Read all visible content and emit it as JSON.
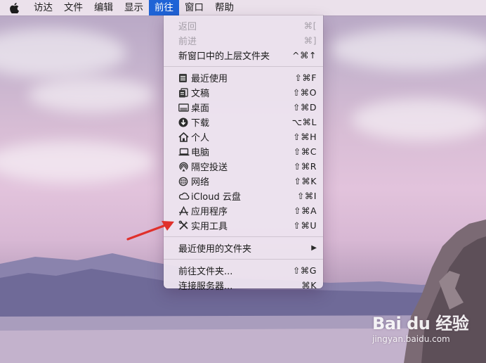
{
  "menubar": {
    "apple_icon": "apple-logo-icon",
    "items": [
      "访达",
      "文件",
      "编辑",
      "显示",
      "前往",
      "窗口",
      "帮助"
    ],
    "active_item": "前往",
    "active_color": "#1f63d6"
  },
  "go_menu": {
    "back": {
      "label": "返回",
      "shortcut": "⌘["
    },
    "forward": {
      "label": "前进",
      "shortcut": "⌘]"
    },
    "enclosing": {
      "label": "新窗口中的上层文件夹",
      "shortcut": "^⌘↑"
    },
    "places": [
      {
        "label": "最近使用",
        "shortcut": "⇧⌘F",
        "icon": "recents-icon"
      },
      {
        "label": "文稿",
        "shortcut": "⇧⌘O",
        "icon": "documents-icon"
      },
      {
        "label": "桌面",
        "shortcut": "⇧⌘D",
        "icon": "desktop-icon"
      },
      {
        "label": "下载",
        "shortcut": "⌥⌘L",
        "icon": "downloads-icon"
      },
      {
        "label": "个人",
        "shortcut": "⇧⌘H",
        "icon": "home-icon"
      },
      {
        "label": "电脑",
        "shortcut": "⇧⌘C",
        "icon": "computer-icon"
      },
      {
        "label": "隔空投送",
        "shortcut": "⇧⌘R",
        "icon": "airdrop-icon"
      },
      {
        "label": "网络",
        "shortcut": "⇧⌘K",
        "icon": "network-icon"
      },
      {
        "label": "iCloud 云盘",
        "shortcut": "⇧⌘I",
        "icon": "icloud-icon"
      },
      {
        "label": "应用程序",
        "shortcut": "⇧⌘A",
        "icon": "applications-icon"
      },
      {
        "label": "实用工具",
        "shortcut": "⇧⌘U",
        "icon": "utilities-icon"
      }
    ],
    "recent_folders": {
      "label": "最近使用的文件夹",
      "submenu_icon": "submenu-arrow-icon"
    },
    "go_to_folder": {
      "label": "前往文件夹...",
      "shortcut": "⇧⌘G"
    },
    "connect_server": {
      "label": "连接服务器...",
      "shortcut": "⌘K"
    }
  },
  "annotation": {
    "arrow_color": "#e0302b",
    "points_to": "实用工具"
  },
  "watermark": {
    "logo": "Bai du 经验",
    "url": "jingyan.baidu.com"
  }
}
